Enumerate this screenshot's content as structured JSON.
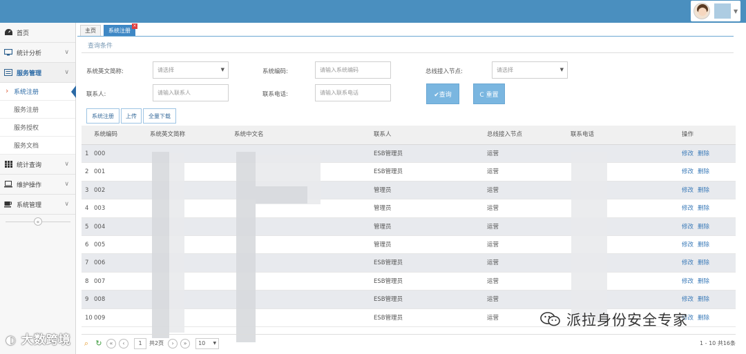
{
  "sidebar": {
    "items": [
      {
        "label": "首页",
        "icon": "dashboard-icon"
      },
      {
        "label": "统计分析",
        "icon": "monitor-icon"
      },
      {
        "label": "服务管理",
        "icon": "list-icon"
      },
      {
        "label": "统计查询",
        "icon": "grid-icon"
      },
      {
        "label": "维护操作",
        "icon": "laptop-icon"
      },
      {
        "label": "系统管理",
        "icon": "coffee-icon"
      }
    ],
    "sub_items": [
      "系统注册",
      "服务注册",
      "服务授权",
      "服务文档"
    ]
  },
  "tabs": [
    {
      "label": "主页"
    },
    {
      "label": "系统注册"
    }
  ],
  "section_title": "查询条件",
  "form": {
    "sys_en_label": "系统英文简称:",
    "sys_en_value": "请选择",
    "sys_code_label": "系统编码:",
    "sys_code_placeholder": "请输入系统编码",
    "bus_node_label": "总线接入节点:",
    "bus_node_value": "请选择",
    "contact_label": "联系人:",
    "contact_placeholder": "请输入联系人",
    "phone_label": "联系电话:",
    "phone_placeholder": "请输入联系电话",
    "query_label": "✔查询",
    "reset_label": "C 重置"
  },
  "toolbar": {
    "register_label": "系统注册",
    "upload_label": "上传",
    "download_label": "全量下载"
  },
  "table": {
    "headers": [
      "系统编码",
      "系统英文简称",
      "系统中文名",
      "联系人",
      "总线接入节点",
      "联系电话",
      "操作"
    ],
    "rows": [
      {
        "n": "1",
        "code": "000",
        "contact": "ESB管理员",
        "node": "运营"
      },
      {
        "n": "2",
        "code": "001",
        "contact": "ESB管理员",
        "node": "运营"
      },
      {
        "n": "3",
        "code": "002",
        "contact": "管理员",
        "node": "运营"
      },
      {
        "n": "4",
        "code": "003",
        "contact": "管理员",
        "node": "运营"
      },
      {
        "n": "5",
        "code": "004",
        "contact": "管理员",
        "node": "运营"
      },
      {
        "n": "6",
        "code": "005",
        "contact": "管理员",
        "node": "运营"
      },
      {
        "n": "7",
        "code": "006",
        "contact": "ESB管理员",
        "node": "运营"
      },
      {
        "n": "8",
        "code": "007",
        "contact": "ESB管理员",
        "node": "运营"
      },
      {
        "n": "9",
        "code": "008",
        "contact": "ESB管理员",
        "node": "运营"
      },
      {
        "n": "10",
        "code": "009",
        "contact": "ESB管理员",
        "node": "运营"
      }
    ],
    "edit_label": "修改",
    "delete_label": "删除"
  },
  "pager": {
    "current_page": "1",
    "total_pages": "共2页",
    "page_size": "10",
    "info": "1 - 10  共16条"
  },
  "watermarks": {
    "left": "大数跨境",
    "right": "派拉身份安全专家"
  },
  "colors": {
    "header": "#4a8fbf",
    "accent": "#3f88c5",
    "link": "#3a7ab8"
  }
}
